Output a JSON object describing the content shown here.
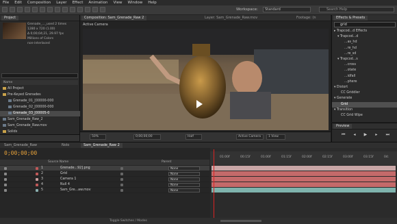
{
  "menu": [
    "File",
    "Edit",
    "Composition",
    "Layer",
    "Effect",
    "Animation",
    "View",
    "Window",
    "Help"
  ],
  "workspace": {
    "label": "Workspace:",
    "value": "Standard",
    "search_placeholder": "Search Help"
  },
  "project": {
    "tab": "Project",
    "info": [
      "Grenade_..._used 2 times",
      "1280 x 720 (1.00)",
      "Δ 0;00;04;21, 29.97 fps",
      "Millions of Colors",
      "non-interlaced"
    ],
    "col_header": "Name",
    "items": [
      {
        "label": "All Project",
        "kind": "folder"
      },
      {
        "label": "Pre-Keyed Grenades",
        "kind": "folder"
      },
      {
        "label": "Grenade_01_[00000-000",
        "kind": "footage"
      },
      {
        "label": "Grenade_02_[00000-000",
        "kind": "footage"
      },
      {
        "label": "Grenade_03_[00005-0",
        "kind": "footage",
        "selected": true
      },
      {
        "label": "Sam_Grenade_Raw_2",
        "kind": "comp"
      },
      {
        "label": "Sam_Grenade_Raw.mov",
        "kind": "footage"
      },
      {
        "label": "Solids",
        "kind": "folder"
      }
    ]
  },
  "viewer": {
    "tabs": [
      "Composition: Sam_Grenade_Raw 2",
      "Layer: Sam_Grenade_Raw.mov",
      "Footage: (n"
    ],
    "camera_label": "Active Camera",
    "zoom": "50%",
    "time": "0;00;00;00",
    "resolution": "Half",
    "view": "Active Camera",
    "views": "1 View"
  },
  "effects": {
    "tab": "Effects & Presets",
    "search": "grid",
    "rows": [
      {
        "label": "▸ Trapcod...d Effects",
        "indent": 0
      },
      {
        "label": "▾ Trapcod...d",
        "indent": 1
      },
      {
        "label": "...as_hd",
        "indent": 3
      },
      {
        "label": "...re_hd",
        "indent": 3
      },
      {
        "label": "...re_sd",
        "indent": 3
      },
      {
        "label": "▾ Trapcod...s",
        "indent": 1
      },
      {
        "label": "...cross",
        "indent": 3
      },
      {
        "label": "...otate",
        "indent": 3
      },
      {
        "label": "...idfall",
        "indent": 3
      },
      {
        "label": "...phere",
        "indent": 3
      },
      {
        "label": "▾ Distort",
        "indent": 0
      },
      {
        "label": "CC Griddler",
        "indent": 2
      },
      {
        "label": "▾ Generate",
        "indent": 0
      },
      {
        "label": "Grid",
        "indent": 2,
        "selected": true
      },
      {
        "label": "▾ Transition",
        "indent": 0
      },
      {
        "label": "CC Grid Wipe",
        "indent": 2
      }
    ]
  },
  "preview": {
    "tab": "Preview"
  },
  "timeline": {
    "tabs": [
      "Sam_Grenade_Raw",
      "Nolo",
      "Sam_Grenade_Raw 2"
    ],
    "timecode": "0;00;00;00",
    "headers": {
      "source": "Source Name",
      "parent": "Parent"
    },
    "ticks": [
      "01:00f",
      "00:15f",
      "01:00f",
      "01:15f",
      "02:00f",
      "02:15f",
      "03:00f",
      "03:15f",
      "04:"
    ],
    "layers": [
      {
        "num": "1",
        "name": "Grenade...92].png",
        "color": "#c05858",
        "parent": "None",
        "bar": "#c9a7a7",
        "selected": true
      },
      {
        "num": "2",
        "name": "Grid",
        "color": "#c05858",
        "parent": "None",
        "bar": "#c46a6a"
      },
      {
        "num": "3",
        "name": "Camera 1",
        "color": "#c9a0a0",
        "parent": "None",
        "bar": "#c46a6a"
      },
      {
        "num": "4",
        "name": "Null 4",
        "color": "#c05858",
        "parent": "None",
        "bar": "#c46a6a"
      },
      {
        "num": "5",
        "name": "Sam_Gre...aw.mov",
        "color": "#8ab0b0",
        "parent": "None",
        "bar": "#7fb3ad"
      }
    ],
    "footer": "Toggle Switches / Modes"
  },
  "colors": {
    "accent": "#e8a23a",
    "cti": "#dd2222"
  }
}
